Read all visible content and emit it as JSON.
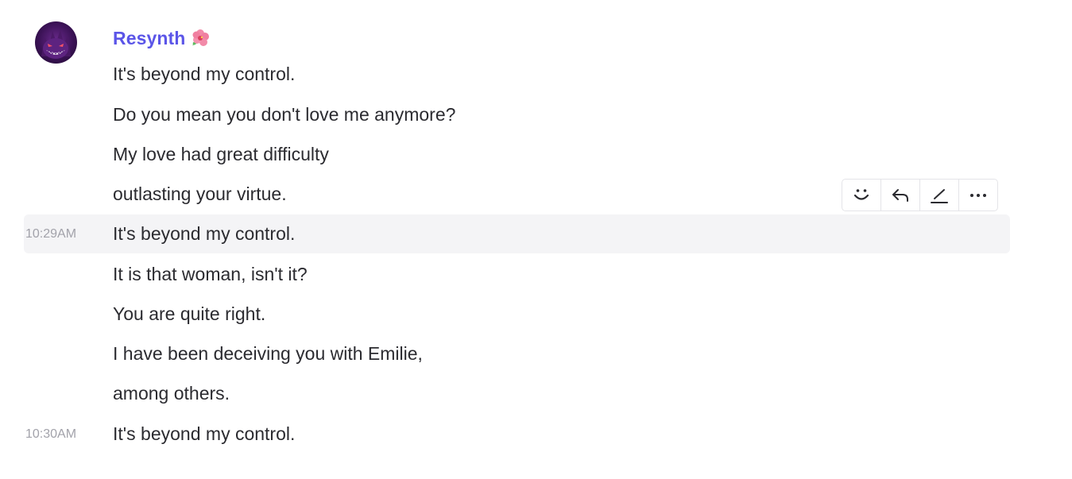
{
  "author": {
    "name": "Resynth",
    "badge_icon": "hibiscus-icon",
    "name_color": "#5b55e8"
  },
  "messages": [
    {
      "time": "",
      "text": "It's beyond my control."
    },
    {
      "time": "",
      "text": "Do you mean you don't love me anymore?"
    },
    {
      "time": "",
      "text": "My love had great difficulty"
    },
    {
      "time": "",
      "text": "outlasting your virtue."
    },
    {
      "time": "10:29AM",
      "text": "It's beyond my control."
    },
    {
      "time": "",
      "text": "It is that woman, isn't it?"
    },
    {
      "time": "",
      "text": "You are quite right."
    },
    {
      "time": "",
      "text": "I have been deceiving you with Emilie,"
    },
    {
      "time": "",
      "text": "among others."
    },
    {
      "time": "10:30AM",
      "text": "It's beyond my control."
    }
  ],
  "hovered_message_index": 4,
  "toolbar": {
    "buttons": [
      {
        "name": "add-reaction-button",
        "icon": "smiley-icon"
      },
      {
        "name": "reply-button",
        "icon": "reply-arrow-icon"
      },
      {
        "name": "edit-button",
        "icon": "pencil-icon"
      },
      {
        "name": "more-options-button",
        "icon": "ellipsis-icon"
      }
    ]
  }
}
